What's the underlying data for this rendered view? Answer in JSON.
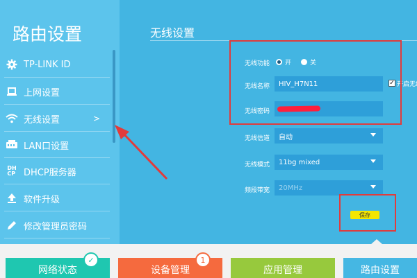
{
  "sidebar": {
    "title": "路由设置",
    "items": [
      {
        "label": "TP-LINK ID",
        "icon": "gear-icon"
      },
      {
        "label": "上网设置",
        "icon": "laptop-icon"
      },
      {
        "label": "无线设置",
        "icon": "wifi-icon",
        "chevron": ">"
      },
      {
        "label": "LAN口设置",
        "icon": "router-icon"
      },
      {
        "label": "DHCP服务器",
        "icon": "dhcp-icon",
        "icon_text": "DH\nCP"
      },
      {
        "label": "软件升级",
        "icon": "upload-icon"
      },
      {
        "label": "修改管理员密码",
        "icon": "pencil-icon"
      }
    ]
  },
  "main": {
    "title": "无线设置",
    "wireless_function": {
      "label": "无线功能",
      "on_label": "开",
      "off_label": "关",
      "selected": "开"
    },
    "ssid": {
      "label": "无线名称",
      "value": "HIV_H7N11",
      "hide_label": "开启无线"
    },
    "password": {
      "label": "无线密码"
    },
    "channel": {
      "label": "无线信道",
      "value": "自动"
    },
    "mode": {
      "label": "无线模式",
      "value": "11bg mixed"
    },
    "bandwidth": {
      "label": "频段带宽",
      "value": "20MHz"
    },
    "save_label": "保存"
  },
  "bottom_tabs": [
    {
      "label": "网络状态",
      "color": "#1fc7b0",
      "badge": "✓"
    },
    {
      "label": "设备管理",
      "color": "#f56a3e",
      "badge": "1"
    },
    {
      "label": "应用管理",
      "color": "#97c93d"
    },
    {
      "label": "路由设置",
      "color": "#45b7e3"
    }
  ],
  "colors": {
    "annotation": "#e23b3b",
    "save_button": "#f3e600"
  }
}
